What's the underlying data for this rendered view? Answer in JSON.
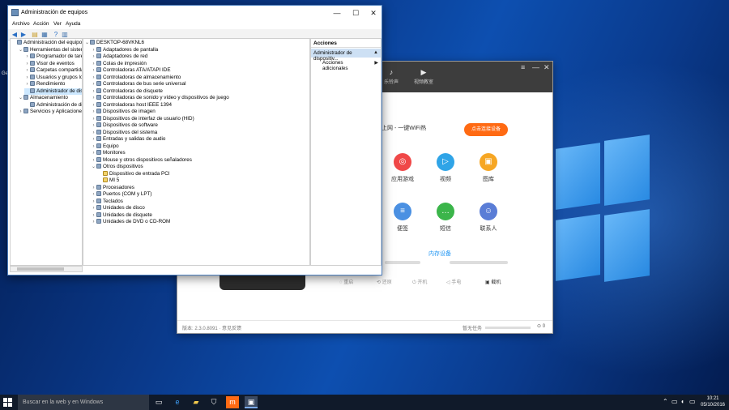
{
  "desktop": {
    "icon_label": "Ge"
  },
  "mgmt_window": {
    "title": "Administración de equipos",
    "menu": [
      "Archivo",
      "Acción",
      "Ver",
      "Ayuda"
    ],
    "left_tree": [
      {
        "label": "Administración del equipo (loc",
        "indent": 0,
        "twisty": "",
        "icon": "computer-icon"
      },
      {
        "label": "Herramientas del sistema",
        "indent": 1,
        "twisty": "⌄",
        "icon": "tools-icon"
      },
      {
        "label": "Programador de tareas",
        "indent": 2,
        "twisty": "›",
        "icon": "clock-icon"
      },
      {
        "label": "Visor de eventos",
        "indent": 2,
        "twisty": "›",
        "icon": "event-viewer-icon"
      },
      {
        "label": "Carpetas compartidas",
        "indent": 2,
        "twisty": "›",
        "icon": "folder-icon"
      },
      {
        "label": "Usuarios y grupos locale",
        "indent": 2,
        "twisty": "›",
        "icon": "users-icon"
      },
      {
        "label": "Rendimiento",
        "indent": 2,
        "twisty": "›",
        "icon": "performance-icon"
      },
      {
        "label": "Administrador de dispo",
        "indent": 2,
        "twisty": "",
        "icon": "device-manager-icon",
        "selected": true
      },
      {
        "label": "Almacenamiento",
        "indent": 1,
        "twisty": "⌄",
        "icon": "storage-icon"
      },
      {
        "label": "Administración de disco",
        "indent": 2,
        "twisty": "",
        "icon": "disk-icon"
      },
      {
        "label": "Servicios y Aplicaciones",
        "indent": 1,
        "twisty": "›",
        "icon": "services-icon"
      }
    ],
    "device_tree": [
      {
        "label": "DESKTOP-68VKNL6",
        "indent": 0,
        "twisty": "⌄",
        "icon": "computer-icon"
      },
      {
        "label": "Adaptadores de pantalla",
        "indent": 1,
        "twisty": "›",
        "icon": "display-adapter-icon"
      },
      {
        "label": "Adaptadores de red",
        "indent": 1,
        "twisty": "›",
        "icon": "network-adapter-icon"
      },
      {
        "label": "Colas de impresión",
        "indent": 1,
        "twisty": "›",
        "icon": "printer-icon"
      },
      {
        "label": "Controladoras ATA/ATAPI IDE",
        "indent": 1,
        "twisty": "›",
        "icon": "ide-icon"
      },
      {
        "label": "Controladoras de almacenamiento",
        "indent": 1,
        "twisty": "›",
        "icon": "storage-controller-icon"
      },
      {
        "label": "Controladoras de bus serie universal",
        "indent": 1,
        "twisty": "›",
        "icon": "usb-icon"
      },
      {
        "label": "Controladoras de disquete",
        "indent": 1,
        "twisty": "›",
        "icon": "floppy-icon"
      },
      {
        "label": "Controladoras de sonido y vídeo y dispositivos de juego",
        "indent": 1,
        "twisty": "›",
        "icon": "sound-icon"
      },
      {
        "label": "Controladoras host IEEE 1394",
        "indent": 1,
        "twisty": "›",
        "icon": "ieee1394-icon"
      },
      {
        "label": "Dispositivos de imagen",
        "indent": 1,
        "twisty": "›",
        "icon": "camera-icon"
      },
      {
        "label": "Dispositivos de interfaz de usuario (HID)",
        "indent": 1,
        "twisty": "›",
        "icon": "hid-icon"
      },
      {
        "label": "Dispositivos de software",
        "indent": 1,
        "twisty": "›",
        "icon": "software-device-icon"
      },
      {
        "label": "Dispositivos del sistema",
        "indent": 1,
        "twisty": "›",
        "icon": "system-device-icon"
      },
      {
        "label": "Entradas y salidas de audio",
        "indent": 1,
        "twisty": "›",
        "icon": "audio-icon"
      },
      {
        "label": "Equipo",
        "indent": 1,
        "twisty": "›",
        "icon": "computer-icon"
      },
      {
        "label": "Monitores",
        "indent": 1,
        "twisty": "›",
        "icon": "monitor-icon"
      },
      {
        "label": "Mouse y otros dispositivos señaladores",
        "indent": 1,
        "twisty": "›",
        "icon": "mouse-icon"
      },
      {
        "label": "Otros dispositivos",
        "indent": 1,
        "twisty": "⌄",
        "icon": "other-devices-icon"
      },
      {
        "label": "Dispositivo de entrada PCI",
        "indent": 2,
        "twisty": "",
        "icon": "warning-device-icon",
        "warn": true
      },
      {
        "label": "MI 5",
        "indent": 2,
        "twisty": "",
        "icon": "warning-device-icon",
        "warn": true
      },
      {
        "label": "Procesadores",
        "indent": 1,
        "twisty": "›",
        "icon": "processor-icon"
      },
      {
        "label": "Puertos (COM y LPT)",
        "indent": 1,
        "twisty": "›",
        "icon": "port-icon"
      },
      {
        "label": "Teclados",
        "indent": 1,
        "twisty": "›",
        "icon": "keyboard-icon"
      },
      {
        "label": "Unidades de disco",
        "indent": 1,
        "twisty": "›",
        "icon": "disk-drive-icon"
      },
      {
        "label": "Unidades de disquete",
        "indent": 1,
        "twisty": "›",
        "icon": "floppy-drive-icon"
      },
      {
        "label": "Unidades de DVD o CD-ROM",
        "indent": 1,
        "twisty": "›",
        "icon": "dvd-icon"
      }
    ],
    "actions": {
      "header": "Acciones",
      "selected": "Administrador de dispositiv...",
      "item": "Acciones adicionales"
    }
  },
  "app_window": {
    "tabs": [
      "乐铃声",
      "视频教室"
    ],
    "wifi_text": "上网 - 一键WiFi热",
    "connect_button": "点击连接设备",
    "features": [
      {
        "label": "应用游戏",
        "color": "#f04848",
        "glyph": "◎"
      },
      {
        "label": "视频",
        "color": "#2fa4e7",
        "glyph": "▷"
      },
      {
        "label": "图库",
        "color": "#f6a623",
        "glyph": "▣"
      },
      {
        "label": "便签",
        "color": "#4a90e2",
        "glyph": "≡"
      },
      {
        "label": "短信",
        "color": "#3bb54a",
        "glyph": "…"
      },
      {
        "label": "联系人",
        "color": "#5a7dd6",
        "glyph": "☺"
      }
    ],
    "memory_label": "内存设备",
    "tools": [
      "重启",
      "还原",
      "开机",
      "手电",
      "截机"
    ],
    "version": "版本: 2.3.0.8091 · 意见反馈",
    "task_label": "暂无任务",
    "download_count": "0"
  },
  "taskbar": {
    "search_placeholder": "Buscar en la web y en Windows",
    "time": "10:21",
    "date": "05/10/2016"
  }
}
